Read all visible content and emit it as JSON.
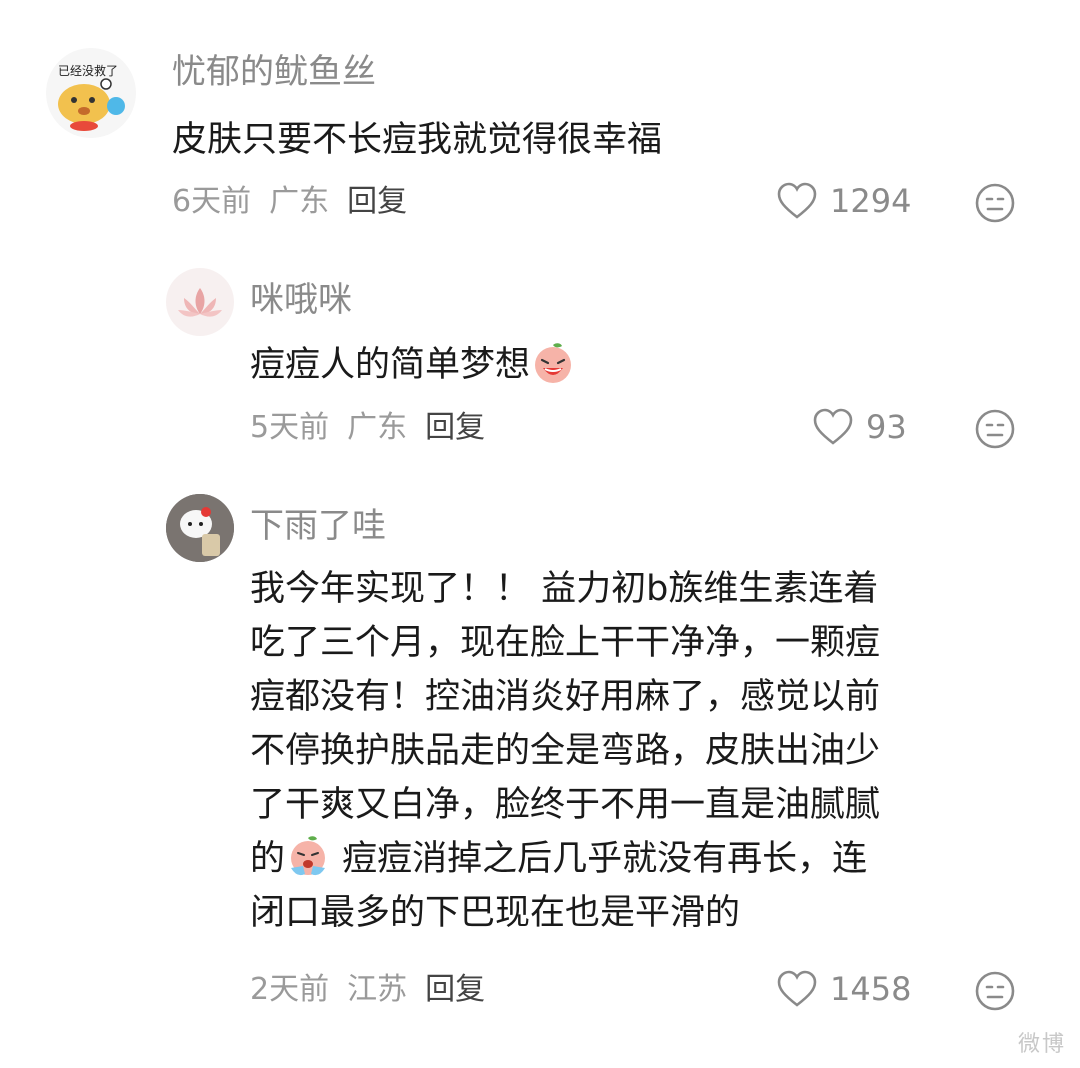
{
  "comments": [
    {
      "username": "忧郁的鱿鱼丝",
      "avatar_text": "已经没救了",
      "text": "皮肤只要不长痘我就觉得很幸福",
      "time": "6天前",
      "location": "广东",
      "reply_label": "回复",
      "likes": "1294"
    },
    {
      "username": "咪哦咪",
      "text": "痘痘人的简单梦想",
      "time": "5天前",
      "location": "广东",
      "reply_label": "回复",
      "likes": "93"
    },
    {
      "username": "下雨了哇",
      "text_lines": [
        "我今年实现了！！ 益力初b族维生素连着",
        "吃了三个月，现在脸上干干净净，一颗痘",
        "痘都没有！控油消炎好用麻了，感觉以前",
        "不停换护肤品走的全是弯路，皮肤出油少",
        "了干爽又白净，脸终于不用一直是油腻腻"
      ],
      "text_line6_a": "的",
      "text_line6_b": " 痘痘消掉之后几乎就没有再长，连",
      "text_line7": "闭口最多的下巴现在也是平滑的",
      "time": "2天前",
      "location": "江苏",
      "reply_label": "回复",
      "likes": "1458"
    }
  ],
  "icons": {
    "like": "heart-outline-icon",
    "dislike": "meh-face-icon",
    "emoji_laugh": "laughing-peach-emoji",
    "emoji_cry": "crying-peach-emoji"
  },
  "watermark": "微博"
}
